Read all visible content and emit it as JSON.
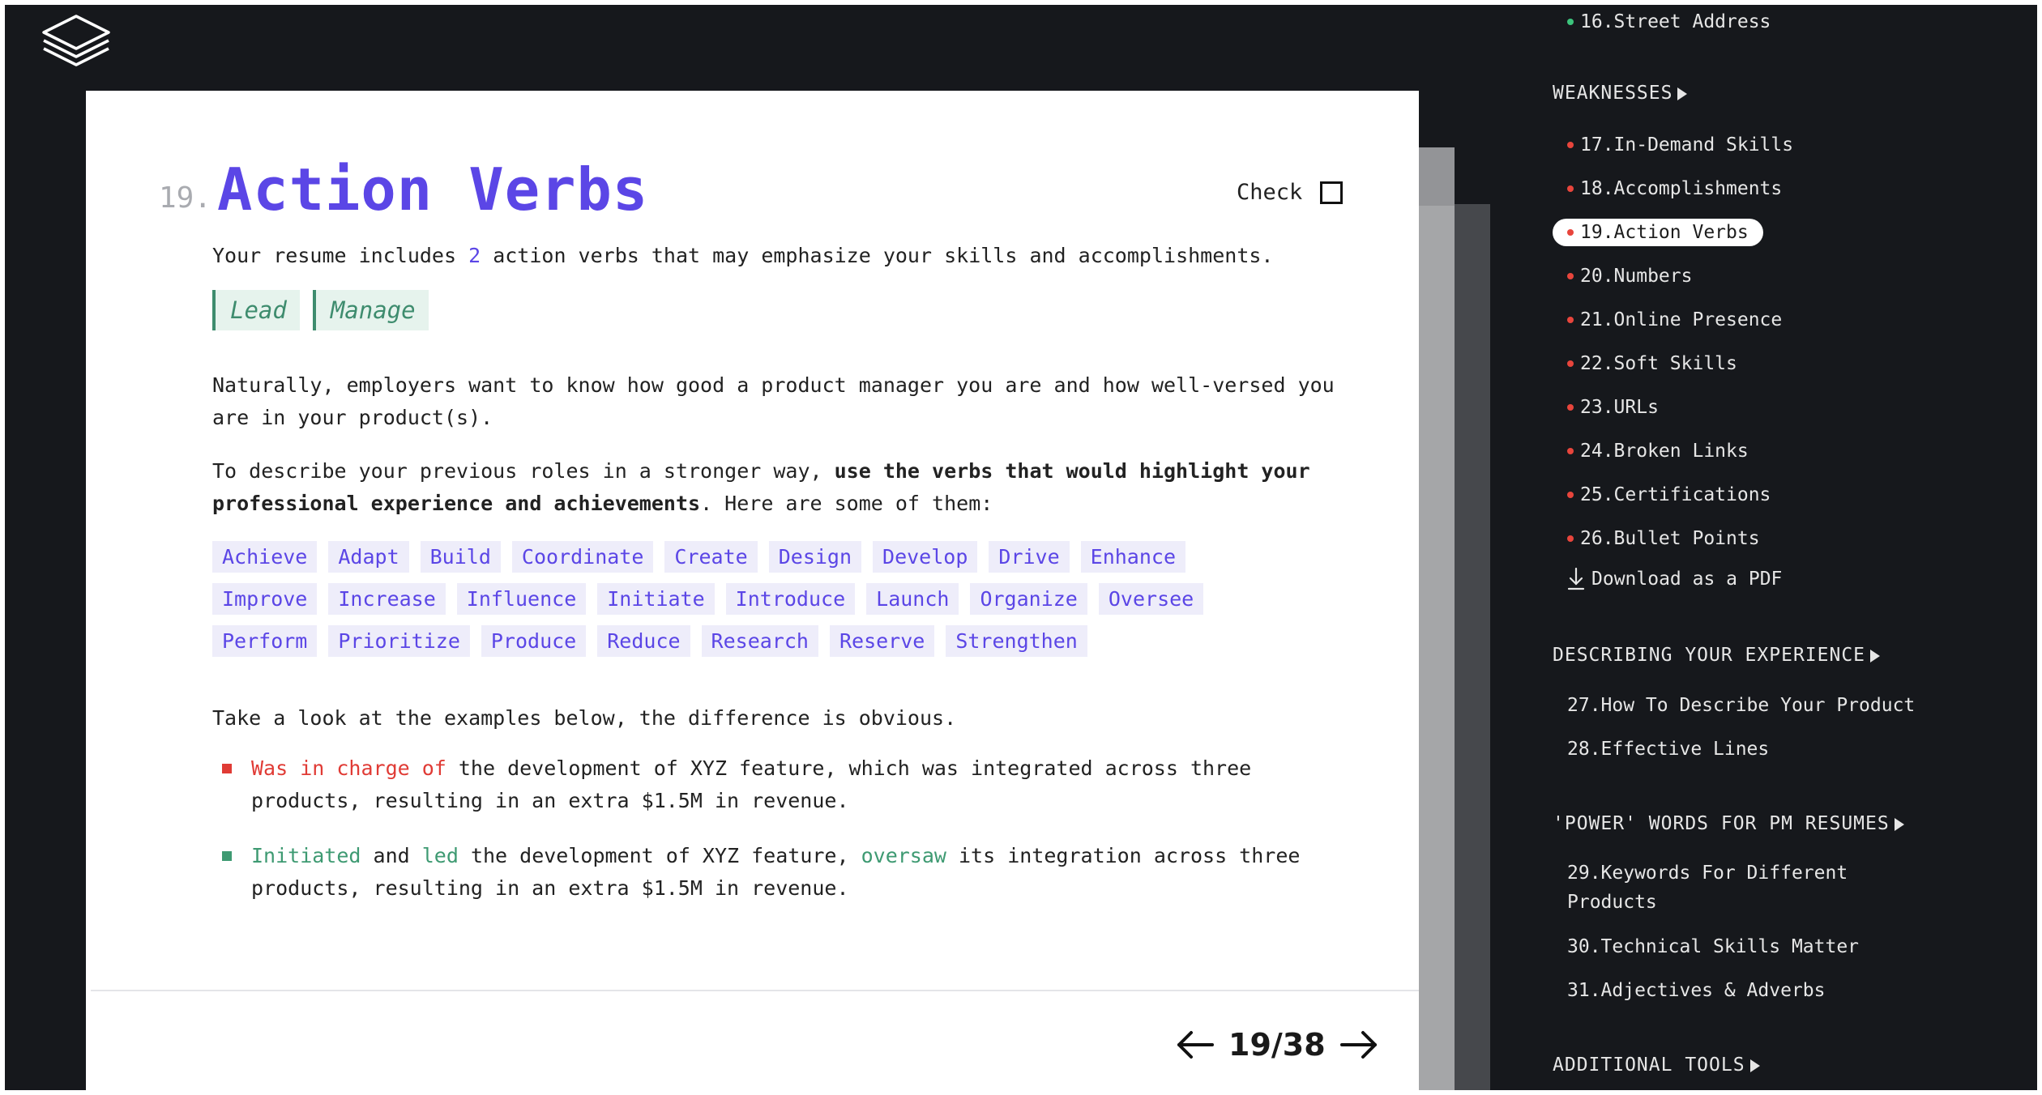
{
  "lesson": {
    "number": "19.",
    "title": "Action Verbs",
    "check_label": "Check",
    "intro_prefix": "Your resume includes ",
    "intro_count": "2",
    "intro_suffix": " action verbs that may emphasize your skills and accomplishments.",
    "found_verbs": [
      "Lead",
      "Manage"
    ],
    "paragraph1": "Naturally, employers want to know how good a product manager you are and how well-versed you are in your product(s).",
    "paragraph2_prefix": "To describe your previous roles in a stronger way, ",
    "paragraph2_bold": "use the verbs that would highlight your professional experience and achievements",
    "paragraph2_suffix": ". Here are some of them:",
    "suggested_verbs": [
      "Achieve",
      "Adapt",
      "Build",
      "Coordinate",
      "Create",
      "Design",
      "Develop",
      "Drive",
      "Enhance",
      "Improve",
      "Increase",
      "Influence",
      "Initiate",
      "Introduce",
      "Launch",
      "Organize",
      "Oversee",
      "Perform",
      "Prioritize",
      "Produce",
      "Reduce",
      "Research",
      "Reserve",
      "Strengthen"
    ],
    "examples_intro": "Take a look at the examples below, the difference is obvious.",
    "bad_example": {
      "highlight": "Was in charge of",
      "text": " the development of XYZ feature, which was integrated across three products, resulting in an extra $1.5M in revenue."
    },
    "good_example": {
      "w1": "Initiated",
      "t1": " and ",
      "w2": "led",
      "t2": " the development of XYZ feature, ",
      "w3": "oversaw",
      "t3": " its integration across three products, resulting in an extra $1.5M in revenue."
    }
  },
  "pager": {
    "text": "19/38",
    "current": 19,
    "total": 38
  },
  "sidebar": {
    "top_item": "16.Street Address",
    "weaknesses_title": "WEAKNESSES",
    "weaknesses_items": [
      "17.In-Demand Skills",
      "18.Accomplishments",
      "19.Action Verbs",
      "20.Numbers",
      "21.Online Presence",
      "22.Soft Skills",
      "23.URLs",
      "24.Broken Links",
      "25.Certifications",
      "26.Bullet Points"
    ],
    "download_label": "Download as a PDF",
    "describing_title": "DESCRIBING YOUR EXPERIENCE",
    "describing_items": [
      "27.How To Describe Your Product",
      "28.Effective Lines"
    ],
    "power_title": "'POWER' WORDS FOR PM RESUMES",
    "power_items": [
      "29.Keywords For Different Products",
      "30.Technical Skills Matter",
      "31.Adjectives & Adverbs"
    ],
    "additional_title": "ADDITIONAL TOOLS"
  },
  "colors": {
    "accent": "#5b46e6",
    "bad": "#e03b35",
    "good": "#3e9a72",
    "status_dot_red": "#e8453c",
    "status_dot_green": "#3cc47c"
  }
}
